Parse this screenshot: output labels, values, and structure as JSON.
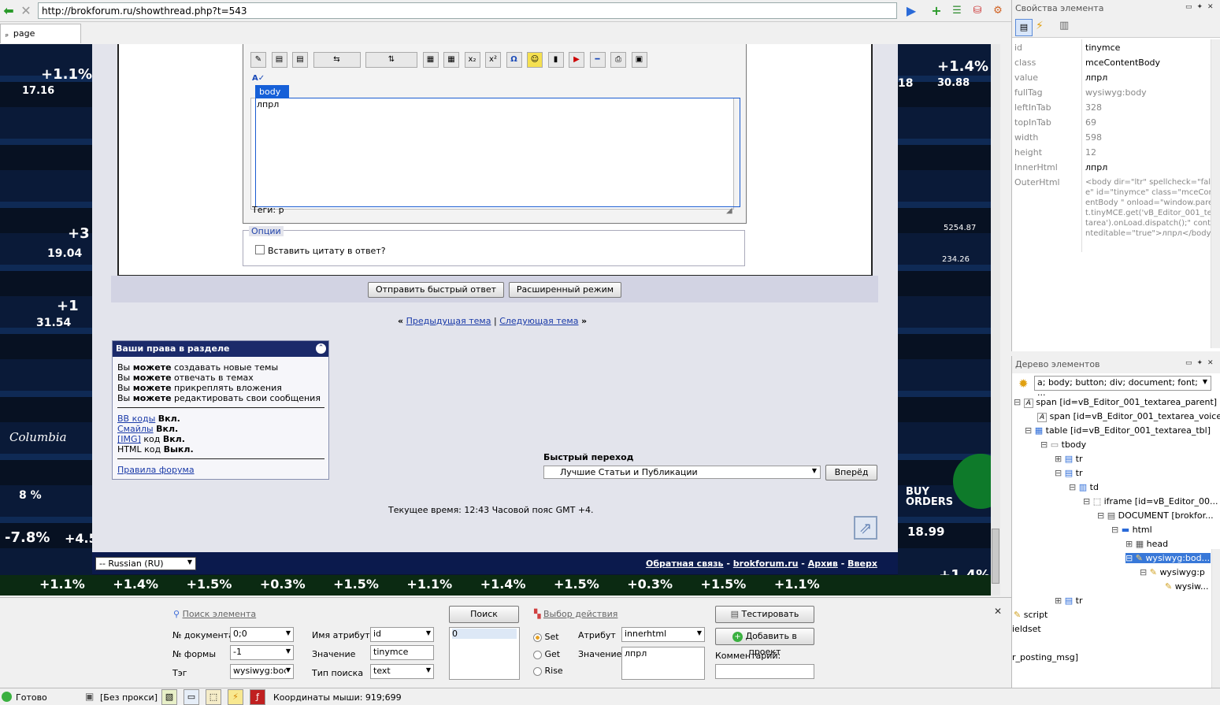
{
  "browser": {
    "url": "http://brokforum.ru/showthread.php?t=543",
    "tab_label": "page"
  },
  "editor": {
    "body_tag": "body",
    "text": "лпрл",
    "tags": "Теги: p",
    "options_legend": "Опции",
    "quote_checkbox_label": "Вставить цитату в ответ?",
    "send_button": "Отправить быстрый ответ",
    "advanced_button": "Расширенный режим"
  },
  "thread_nav": {
    "prev_arrow": "«",
    "prev": "Предыдущая тема",
    "separator": "|",
    "next": "Следующая тема",
    "next_arrow": "»"
  },
  "rights": {
    "title": "Ваши права в разделе",
    "lines": [
      {
        "pre": "Вы ",
        "bold": "можете",
        "post": " создавать новые темы"
      },
      {
        "pre": "Вы ",
        "bold": "можете",
        "post": " отвечать в темах"
      },
      {
        "pre": "Вы ",
        "bold": "можете",
        "post": " прикреплять вложения"
      },
      {
        "pre": "Вы ",
        "bold": "можете",
        "post": " редактировать свои сообщения"
      }
    ],
    "codes": [
      {
        "link": "BB коды",
        "text": "",
        "value": "Вкл."
      },
      {
        "link": "Смайлы",
        "text": "",
        "value": "Вкл."
      },
      {
        "link": "[IMG]",
        "text": " код",
        "value": "Вкл."
      },
      {
        "link": "",
        "text": "HTML код",
        "value": "Выкл."
      }
    ],
    "rules_link": "Правила форума"
  },
  "quick_jump": {
    "label": "Быстрый переход",
    "selected": "Лучшие Статьи и Публикации",
    "go_button": "Вперёд"
  },
  "current_time": "Текущее время: 12:43 Часовой пояс GMT +4.",
  "footer": {
    "language": "-- Russian (RU)",
    "links": [
      "Обратная связь",
      "brokforum.ru",
      "Архив",
      "Вверх"
    ],
    "separator": "-"
  },
  "properties_panel": {
    "title": "Свойства элемента",
    "rows": [
      {
        "key": "id",
        "value": "tinymce"
      },
      {
        "key": "class",
        "value": "mceContentBody"
      },
      {
        "key": "value",
        "value": "лпрл"
      },
      {
        "key": "fullTag",
        "value": "wysiwyg:body"
      },
      {
        "key": "leftInTab",
        "value": "328"
      },
      {
        "key": "topInTab",
        "value": "69"
      },
      {
        "key": "width",
        "value": "598"
      },
      {
        "key": "height",
        "value": "12"
      },
      {
        "key": "InnerHtml",
        "value": "лпрл"
      },
      {
        "key": "OuterHtml",
        "value": "<body dir=\"ltr\" spellcheck=\"false\" id=\"tinymce\" class=\"mceContentBody \" onload=\"window.parent.tinyMCE.get('vB_Editor_001_textarea').onLoad.dispatch();\" contenteditable=\"true\">лпрл</body>"
      }
    ]
  },
  "tree_panel": {
    "title": "Дерево элементов",
    "filter": "a; body; button; div; document; font; ...",
    "nodes": [
      {
        "text": "span [id=vB_Editor_001_textarea_parent]"
      },
      {
        "text": "span [id=vB_Editor_001_textarea_voice]"
      },
      {
        "text": "table [id=vB_Editor_001_textarea_tbl]"
      },
      {
        "text": "tbody"
      },
      {
        "text": "tr"
      },
      {
        "text": "tr"
      },
      {
        "text": "td"
      },
      {
        "text": "iframe [id=vB_Editor_00..."
      },
      {
        "text": "DOCUMENT [brokfor..."
      },
      {
        "text": "html"
      },
      {
        "text": "head"
      },
      {
        "text": "wysiwyg:bod..."
      },
      {
        "text": "wysiwyg:p"
      },
      {
        "text": "wysiw..."
      },
      {
        "text": "tr"
      },
      {
        "text": "script"
      },
      {
        "text": "ieldset"
      },
      {
        "text": "r_posting_msg]"
      }
    ]
  },
  "search_panel": {
    "find_link": "Поиск элемента",
    "doc_num_label": "№ документа",
    "doc_num_value": "0;0",
    "form_num_label": "№ формы",
    "form_num_value": "-1",
    "tag_label": "Тэг",
    "tag_value": "wysiwyg:bod",
    "attr_name_label": "Имя атрибута",
    "attr_name_value": "id",
    "value_label": "Значение",
    "value_value": "tinymce",
    "search_type_label": "Тип поиска",
    "search_type_value": "text",
    "search_button": "Поиск",
    "result_value": "0",
    "action_link": "Выбор действия",
    "radio_set": "Set",
    "radio_get": "Get",
    "radio_rise": "Rise",
    "attribute_label": "Атрибут",
    "attribute_value": "innerhtml",
    "action_value_label": "Значение",
    "action_value": "лпрл",
    "test_button": "Тестировать",
    "add_button": "Добавить в проект",
    "comment_label": "Комментарий:"
  },
  "statusbar": {
    "ready": "Готово",
    "proxy": "[Без прокси]",
    "mouse": "Координаты мыши: 919;699"
  },
  "ticker": {
    "left": [
      "+1.1%",
      "17.16",
      "+3",
      "19.04",
      "+1",
      "31.54",
      "Columbia",
      "8 %",
      "-7.8%",
      "+4.5"
    ],
    "right": [
      "+1.4%",
      "18",
      "30.88",
      "5254.87",
      "234.26",
      "BUY ORDERS",
      "18.99",
      "+1.4%"
    ],
    "bottom": [
      "+1.1%",
      "+1.4%",
      "+1.5%",
      "+0.3%",
      "+1.5%",
      "+1.1%",
      "+1.4%",
      "+1.5%",
      "+0.3%",
      "+1.5%",
      "+1.1%"
    ]
  }
}
